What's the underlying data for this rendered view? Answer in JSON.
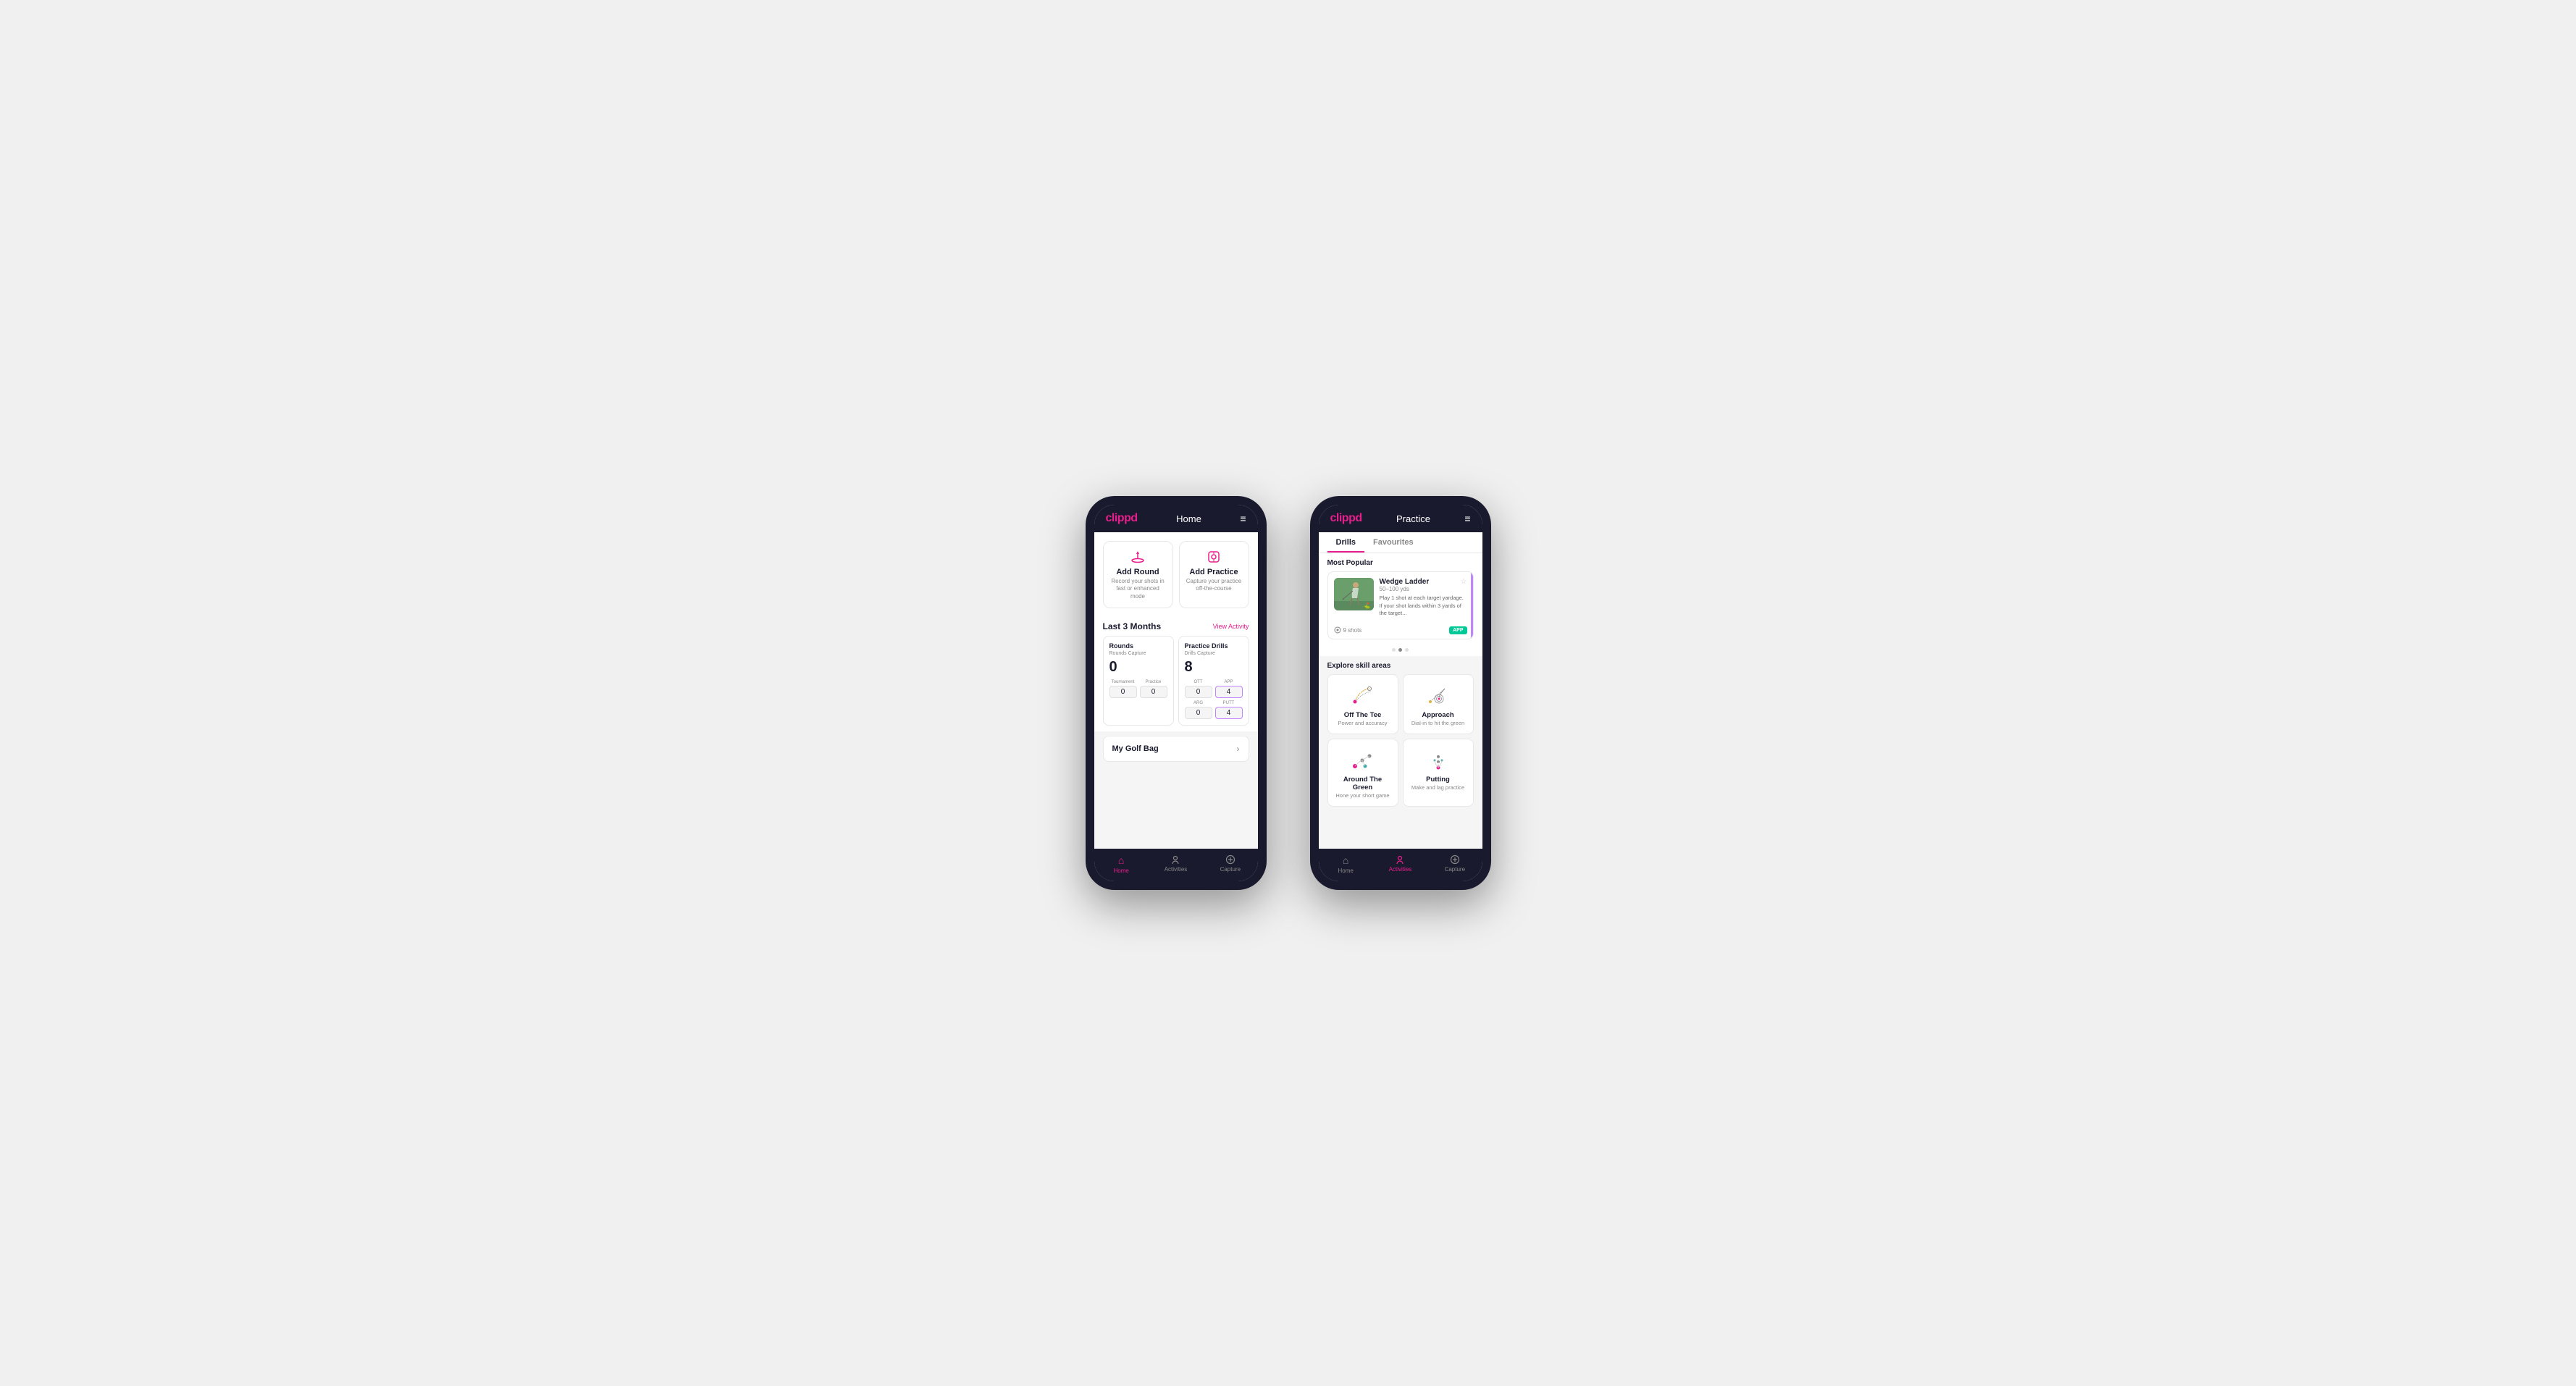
{
  "phone1": {
    "header": {
      "logo": "clippd",
      "title": "Home",
      "menu_icon": "≡"
    },
    "actions": [
      {
        "id": "add-round",
        "title": "Add Round",
        "desc": "Record your shots in fast or enhanced mode",
        "icon": "flag"
      },
      {
        "id": "add-practice",
        "title": "Add Practice",
        "desc": "Capture your practice off-the-course",
        "icon": "target"
      }
    ],
    "last3months": {
      "label": "Last 3 Months",
      "link": "View Activity"
    },
    "rounds": {
      "title": "Rounds",
      "capture_label": "Rounds Capture",
      "total": "0",
      "rows": [
        {
          "label": "Tournament",
          "value": "0"
        },
        {
          "label": "Practice",
          "value": "0"
        }
      ]
    },
    "drills": {
      "title": "Practice Drills",
      "capture_label": "Drills Capture",
      "total": "8",
      "cells": [
        {
          "label": "OTT",
          "value": "0"
        },
        {
          "label": "APP",
          "value": "4",
          "highlight": true
        },
        {
          "label": "ARG",
          "value": "0"
        },
        {
          "label": "PUTT",
          "value": "4",
          "highlight": true
        }
      ]
    },
    "golf_bag": {
      "label": "My Golf Bag"
    },
    "nav": [
      {
        "id": "home",
        "label": "Home",
        "icon": "🏠",
        "active": true
      },
      {
        "id": "activities",
        "label": "Activities",
        "icon": "⛳",
        "active": false
      },
      {
        "id": "capture",
        "label": "Capture",
        "icon": "➕",
        "active": false
      }
    ]
  },
  "phone2": {
    "header": {
      "logo": "clippd",
      "title": "Practice",
      "menu_icon": "≡"
    },
    "tabs": [
      {
        "id": "drills",
        "label": "Drills",
        "active": true
      },
      {
        "id": "favourites",
        "label": "Favourites",
        "active": false
      }
    ],
    "most_popular": {
      "section_label": "Most Popular",
      "card": {
        "title": "Wedge Ladder",
        "subtitle": "50–100 yds",
        "desc": "Play 1 shot at each target yardage. If your shot lands within 3 yards of the target...",
        "shots": "9 shots",
        "badge": "APP"
      }
    },
    "dots": [
      {
        "active": false
      },
      {
        "active": true
      },
      {
        "active": false
      }
    ],
    "explore": {
      "title": "Explore skill areas",
      "skills": [
        {
          "id": "off-the-tee",
          "title": "Off The Tee",
          "desc": "Power and accuracy"
        },
        {
          "id": "approach",
          "title": "Approach",
          "desc": "Dial-in to hit the green"
        },
        {
          "id": "around-the-green",
          "title": "Around The Green",
          "desc": "Hone your short game"
        },
        {
          "id": "putting",
          "title": "Putting",
          "desc": "Make and lag practice"
        }
      ]
    },
    "nav": [
      {
        "id": "home",
        "label": "Home",
        "icon": "🏠",
        "active": false
      },
      {
        "id": "activities",
        "label": "Activities",
        "icon": "⛳",
        "active": true
      },
      {
        "id": "capture",
        "label": "Capture",
        "icon": "➕",
        "active": false
      }
    ]
  }
}
